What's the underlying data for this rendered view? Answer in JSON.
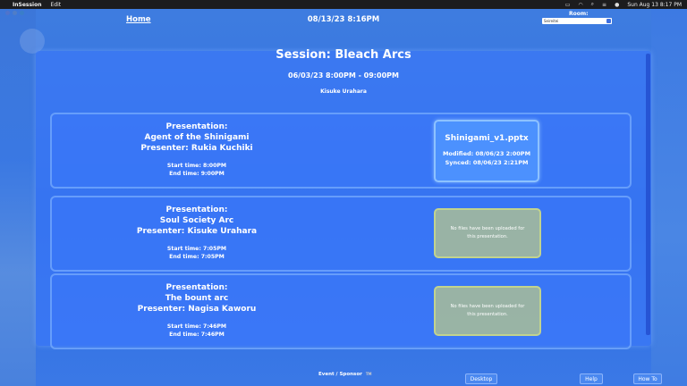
{
  "menubar": {
    "app_name": "InSession",
    "menus": [
      "Edit"
    ],
    "clock": "Sun Aug 13  8:17 PM",
    "status_icons": [
      "battery-icon",
      "wifi-icon",
      "search-icon",
      "control-center-icon",
      "siri-icon"
    ]
  },
  "header": {
    "home_label": "Home",
    "datetime": "08/13/23 8:16PM",
    "room_label": "Room:",
    "room_value": "Seireitei"
  },
  "session": {
    "title": "Session: Bleach Arcs",
    "time": "06/03/23 8:00PM - 09:00PM",
    "host": "Kisuke Urahara"
  },
  "presentations": [
    {
      "label": "Presentation:",
      "title": "Agent of the Shinigami",
      "presenter": "Presenter: Rukia Kuchiki",
      "start": "Start time: 8:00PM",
      "end": "End time: 9:00PM",
      "file": {
        "name": "Shinigami_v1.pptx",
        "modified": "Modified: 08/06/23 2:00PM",
        "synced": "Synced: 08/06/23 2:21PM"
      }
    },
    {
      "label": "Presentation:",
      "title": "Soul Society Arc",
      "presenter": "Presenter: Kisuke Urahara",
      "start": "Start time: 7:05PM",
      "end": "End time: 7:05PM",
      "no_files": "No files have been uploaded for this presentation."
    },
    {
      "label": "Presentation:",
      "title": "The bount arc",
      "presenter": "Presenter: Nagisa Kaworu",
      "start": "Start time: 7:46PM",
      "end": "End time: 7:46PM",
      "no_files": "No files have been uploaded for this presentation."
    }
  ],
  "footer": {
    "sponsor": "Event / Sponsor",
    "tm": "TM",
    "desktop": "Desktop",
    "help": "Help",
    "howto": "How To"
  },
  "colors": {
    "background": "#2f6fe0",
    "panel": "#3c78ff",
    "file_box": "#5096ff",
    "no_file_box": "#aabe96"
  }
}
